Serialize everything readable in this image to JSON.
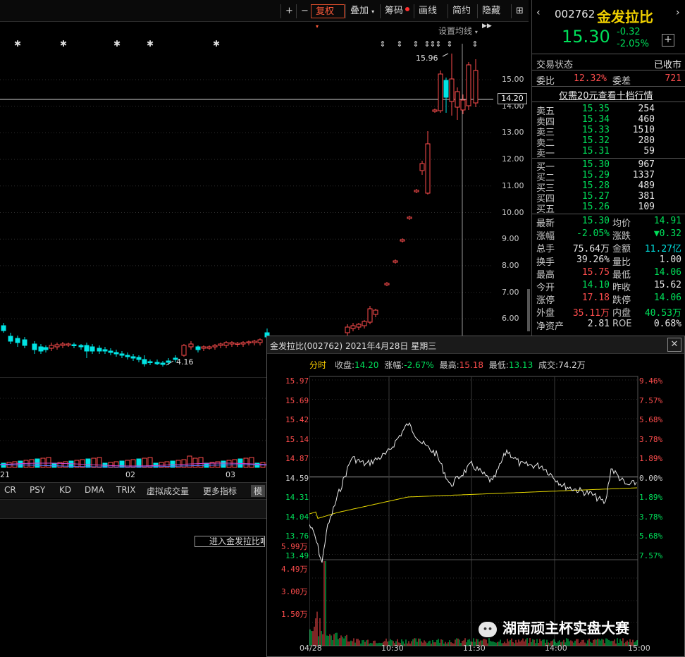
{
  "toolbar": {
    "buttons": [
      "+",
      "−",
      "复权",
      "叠加",
      "筹码",
      "画线",
      "简约",
      "隐藏"
    ],
    "ma_setting": "设置均线"
  },
  "main_chart": {
    "price_axis": [
      "15.00",
      "14.00",
      "13.00",
      "12.00",
      "11.00",
      "10.00",
      "9.00",
      "8.00",
      "7.00",
      "6.00"
    ],
    "current_price_tag": "14.20",
    "high_marker": "15.96",
    "low_marker": "4.16",
    "date_labels": [
      "21",
      "02",
      "03"
    ],
    "enter_button": "进入金发拉比吧"
  },
  "indicator_tabs": [
    "CR",
    "PSY",
    "KD",
    "DMA",
    "TRIX",
    "虚拟成交量",
    "更多指标",
    "模"
  ],
  "quote": {
    "code": "002762",
    "name": "金发拉比",
    "price": "15.30",
    "change": "-0.32",
    "change_pct": "-2.05%",
    "trade_status_label": "交易状态",
    "trade_status": "已收市",
    "weibi_label": "委比",
    "weibi": "12.32%",
    "weicha_label": "委差",
    "weicha": "721",
    "level10_link": "仅需20元查看十档行情",
    "asks": [
      {
        "label": "卖五",
        "price": "15.35",
        "vol": "254"
      },
      {
        "label": "卖四",
        "price": "15.34",
        "vol": "460"
      },
      {
        "label": "卖三",
        "price": "15.33",
        "vol": "1510"
      },
      {
        "label": "卖二",
        "price": "15.32",
        "vol": "280"
      },
      {
        "label": "卖一",
        "price": "15.31",
        "vol": "59"
      }
    ],
    "bids": [
      {
        "label": "买一",
        "price": "15.30",
        "vol": "967"
      },
      {
        "label": "买二",
        "price": "15.29",
        "vol": "1337"
      },
      {
        "label": "买三",
        "price": "15.28",
        "vol": "489"
      },
      {
        "label": "买四",
        "price": "15.27",
        "vol": "381"
      },
      {
        "label": "买五",
        "price": "15.26",
        "vol": "109"
      }
    ],
    "stats": [
      {
        "l1": "最新",
        "v1": "15.30",
        "c1": "green",
        "l2": "均价",
        "v2": "14.91",
        "c2": "green"
      },
      {
        "l1": "涨幅",
        "v1": "-2.05%",
        "c1": "green",
        "l2": "涨跌",
        "v2": "▼0.32",
        "c2": "green"
      },
      {
        "l1": "总手",
        "v1": "75.64万",
        "c1": "white",
        "l2": "金额",
        "v2": "11.27亿",
        "c2": "cyan"
      },
      {
        "l1": "换手",
        "v1": "39.26%",
        "c1": "white",
        "l2": "量比",
        "v2": "1.00",
        "c2": "white"
      },
      {
        "l1": "最高",
        "v1": "15.75",
        "c1": "red",
        "l2": "最低",
        "v2": "14.06",
        "c2": "green"
      },
      {
        "l1": "今开",
        "v1": "14.10",
        "c1": "green",
        "l2": "昨收",
        "v2": "15.62",
        "c2": "white"
      },
      {
        "l1": "涨停",
        "v1": "17.18",
        "c1": "red",
        "l2": "跌停",
        "v2": "14.06",
        "c2": "green"
      },
      {
        "l1": "外盘",
        "v1": "35.11万",
        "c1": "red",
        "l2": "内盘",
        "v2": "40.53万",
        "c2": "green"
      },
      {
        "l1": "净资产",
        "v1": "2.81",
        "c1": "white",
        "l2": "ROE",
        "v2": "0.68%",
        "c2": "white"
      }
    ]
  },
  "popup": {
    "title": "金发拉比(002762) 2021年4月28日 星期三",
    "tab": "分时",
    "close_label": "收盘:",
    "close": "14.20",
    "chg_label": "涨幅:",
    "chg": "-2.67%",
    "high_label": "最高:",
    "high": "15.18",
    "low_label": "最低:",
    "low": "13.13",
    "vol_label": "成交:",
    "vol": "74.2万",
    "left_axis": [
      "15.97",
      "15.69",
      "15.42",
      "15.14",
      "14.87",
      "14.59",
      "14.31",
      "14.04",
      "13.76",
      "13.49"
    ],
    "right_axis": [
      "9.46%",
      "7.57%",
      "5.68%",
      "3.78%",
      "1.89%",
      "0.00%",
      "1.89%",
      "3.78%",
      "5.68%",
      "7.57%"
    ],
    "vol_axis": [
      "5.99万",
      "4.49万",
      "3.00万",
      "1.50万"
    ],
    "time_axis": [
      "04/28",
      "10:30",
      "11:30",
      "14:00",
      "15:00"
    ],
    "watermark": "湖南顽主杯实盘大赛"
  }
}
